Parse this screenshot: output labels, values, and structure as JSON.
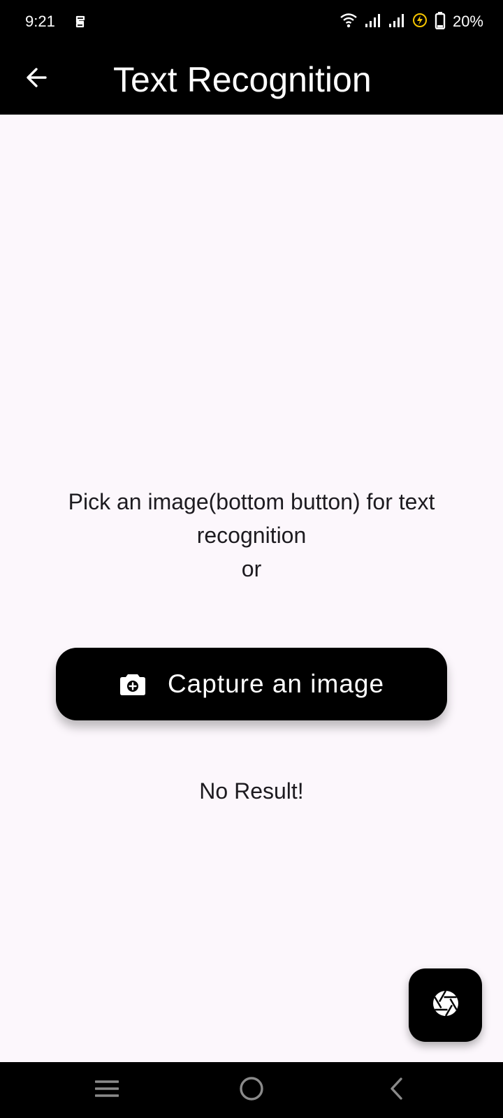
{
  "status_bar": {
    "time": "9:21",
    "battery": "20%",
    "icons": [
      "app-notification-icon",
      "wifi-icon",
      "signal-icon",
      "signal-icon",
      "charging-icon",
      "battery-icon"
    ],
    "charging_color": "#f7c600"
  },
  "app_bar": {
    "back_icon": "arrow-back-icon",
    "title": "Text Recognition"
  },
  "main": {
    "instruction_line1": "Pick an image(bottom button) for text",
    "instruction_line2": "recognition",
    "instruction_line3": "or",
    "capture_button": {
      "icon": "camera-icon",
      "label": "Capture an image"
    },
    "result": "No Result!"
  },
  "fab": {
    "icon": "camera-shutter-icon"
  },
  "nav_bar": {
    "icons": [
      "menu-icon",
      "home-icon",
      "back-icon"
    ]
  },
  "colors": {
    "background": "#fcf7fc",
    "bars": "#000000",
    "button": "#000000",
    "text": "#1d1b20"
  }
}
